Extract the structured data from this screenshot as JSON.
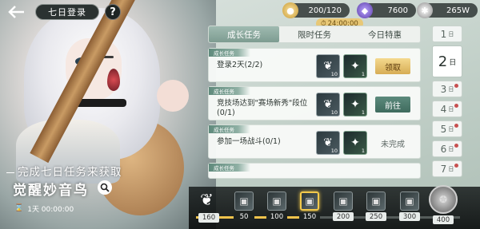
{
  "header": {
    "title": "七日登录",
    "help_label": "?"
  },
  "currencies": [
    {
      "name": "gold-coin",
      "value": "200/120"
    },
    {
      "name": "purple-gem",
      "value": "7600"
    },
    {
      "name": "silver-gear",
      "value": "265W"
    }
  ],
  "timer_tag": "24:00:00",
  "tabs": [
    {
      "label": "成长任务",
      "active": true
    },
    {
      "label": "限时任务",
      "active": false
    },
    {
      "label": "今日特惠",
      "active": false
    }
  ],
  "tasks": [
    {
      "category": "成长任务",
      "desc": "登录2天(2/2)",
      "rewards": [
        {
          "icon": "feather",
          "count": "10"
        },
        {
          "icon": "sword",
          "count": "1"
        }
      ],
      "action": "领取",
      "action_type": "claim"
    },
    {
      "category": "成长任务",
      "desc": "竞技场达到\"赛场新秀\"段位 (0/1)",
      "rewards": [
        {
          "icon": "feather",
          "count": "10"
        },
        {
          "icon": "sword",
          "count": "1"
        }
      ],
      "action": "前往",
      "action_type": "go"
    },
    {
      "category": "成长任务",
      "desc": "参加一场战斗(0/1)",
      "rewards": [
        {
          "icon": "feather",
          "count": "10"
        },
        {
          "icon": "sword",
          "count": "1"
        }
      ],
      "action": "未完成",
      "action_type": "todo"
    },
    {
      "category": "成长任务",
      "desc": "",
      "rewards": [],
      "action": "",
      "action_type": "todo"
    }
  ],
  "days": [
    {
      "num": "1",
      "unit": "日",
      "active": false,
      "dot": false
    },
    {
      "num": "2",
      "unit": "日",
      "active": true,
      "dot": false
    },
    {
      "num": "3",
      "unit": "日",
      "active": false,
      "dot": true
    },
    {
      "num": "4",
      "unit": "日",
      "active": false,
      "dot": true
    },
    {
      "num": "5",
      "unit": "日",
      "active": false,
      "dot": true
    },
    {
      "num": "6",
      "unit": "日",
      "active": false,
      "dot": true
    },
    {
      "num": "7",
      "unit": "日",
      "active": false,
      "dot": true
    }
  ],
  "promo": {
    "subtitle": "完成七日任务来获取",
    "title": "觉醒妙音鸟",
    "countdown": "1天 00:00:00"
  },
  "progress": {
    "start_label": "160",
    "fill_fraction": 0.42,
    "milestones": [
      "50",
      "100",
      "150",
      "200",
      "250",
      "300",
      "400"
    ],
    "highlighted_index": 2,
    "reached_count": 3
  },
  "colors": {
    "accent_green": "#7d9c91",
    "claim_gold": "#d7ad55",
    "progress_yellow": "#f0c34c"
  }
}
